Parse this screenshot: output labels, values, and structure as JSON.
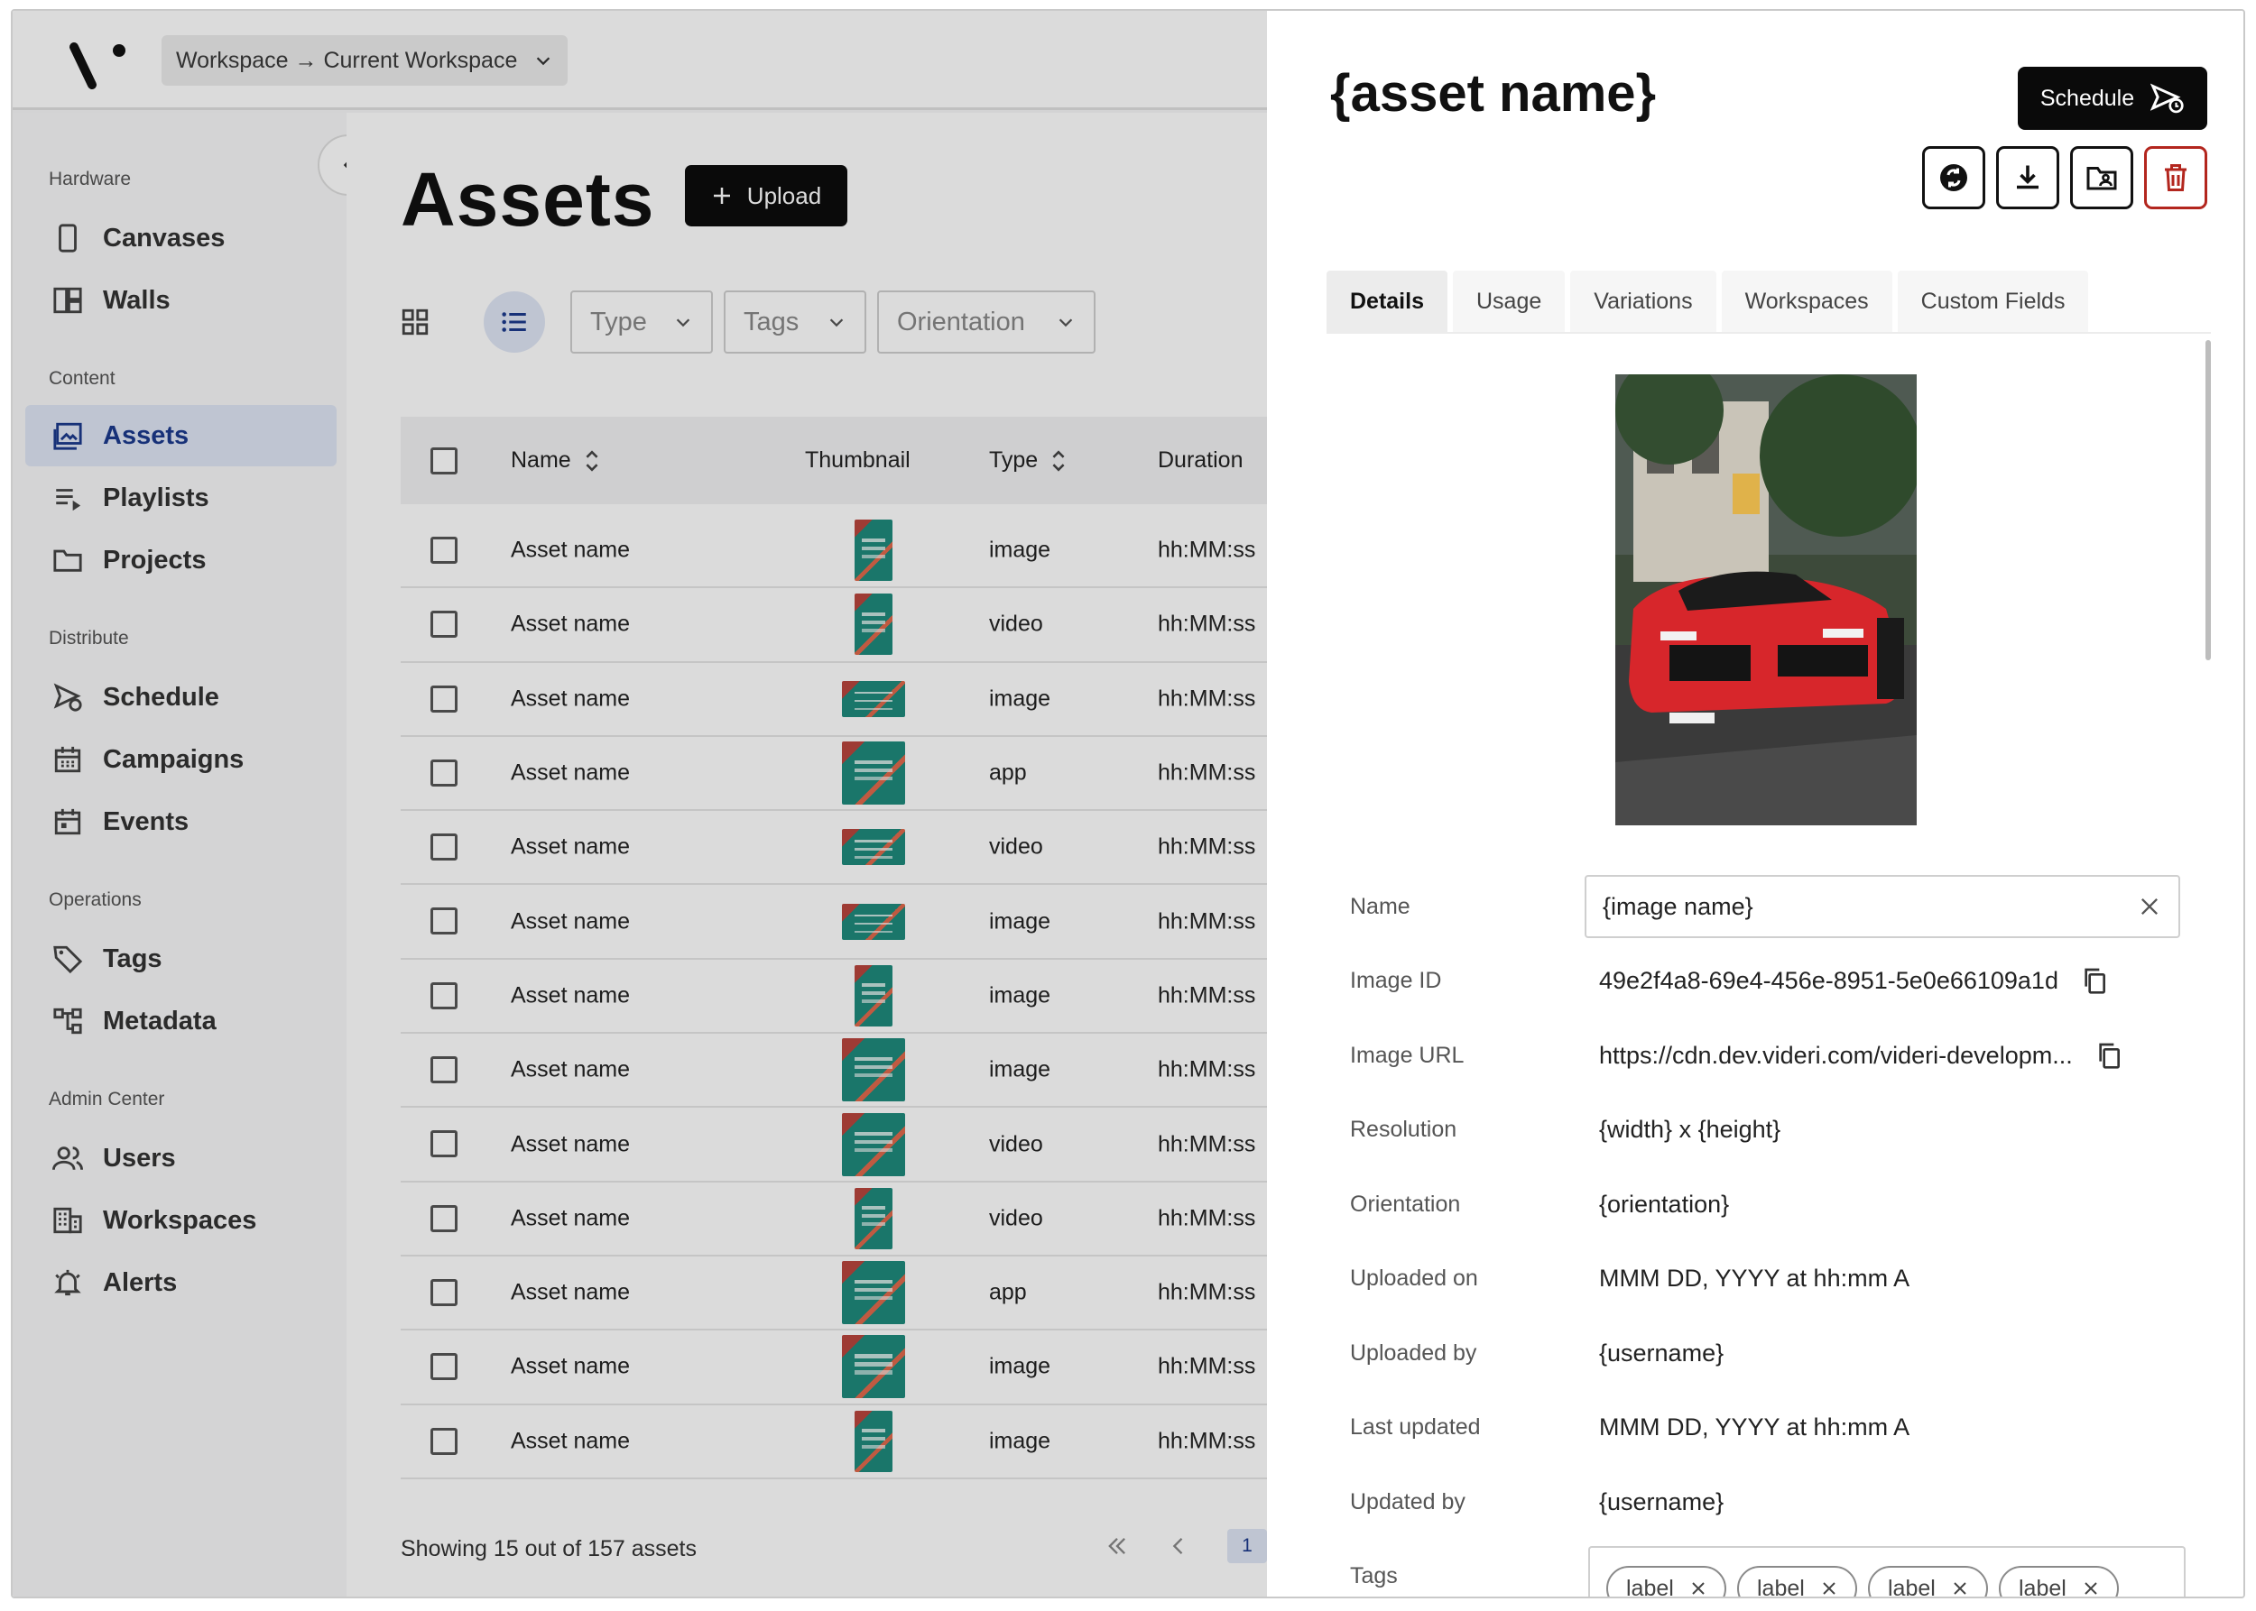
{
  "topbar": {
    "workspace_select": "Workspace → Current Workspace"
  },
  "sidebar": {
    "groups": [
      {
        "label": "Hardware",
        "items": [
          "Canvases",
          "Walls"
        ]
      },
      {
        "label": "Content",
        "items": [
          "Assets",
          "Playlists",
          "Projects"
        ]
      },
      {
        "label": "Distribute",
        "items": [
          "Schedule",
          "Campaigns",
          "Events"
        ]
      },
      {
        "label": "Operations",
        "items": [
          "Tags",
          "Metadata"
        ]
      },
      {
        "label": "Admin Center",
        "items": [
          "Users",
          "Workspaces",
          "Alerts"
        ]
      }
    ],
    "active_item": "Assets"
  },
  "main": {
    "title": "Assets",
    "upload_label": "Upload",
    "filters": [
      "Type",
      "Tags",
      "Orientation"
    ],
    "table": {
      "columns": [
        "Name",
        "Thumbnail",
        "Type",
        "Duration"
      ],
      "rows": [
        {
          "name": "Asset name",
          "thumb": "portrait",
          "type": "image",
          "duration": "hh:MM:ss"
        },
        {
          "name": "Asset name",
          "thumb": "portrait",
          "type": "video",
          "duration": "hh:MM:ss"
        },
        {
          "name": "Asset name",
          "thumb": "landscape",
          "type": "image",
          "duration": "hh:MM:ss"
        },
        {
          "name": "Asset name",
          "thumb": "square",
          "type": "app",
          "duration": "hh:MM:ss"
        },
        {
          "name": "Asset name",
          "thumb": "landscape",
          "type": "video",
          "duration": "hh:MM:ss"
        },
        {
          "name": "Asset name",
          "thumb": "landscape",
          "type": "image",
          "duration": "hh:MM:ss"
        },
        {
          "name": "Asset name",
          "thumb": "portrait",
          "type": "image",
          "duration": "hh:MM:ss"
        },
        {
          "name": "Asset name",
          "thumb": "square",
          "type": "image",
          "duration": "hh:MM:ss"
        },
        {
          "name": "Asset name",
          "thumb": "square",
          "type": "video",
          "duration": "hh:MM:ss"
        },
        {
          "name": "Asset name",
          "thumb": "portrait",
          "type": "video",
          "duration": "hh:MM:ss"
        },
        {
          "name": "Asset name",
          "thumb": "square",
          "type": "app",
          "duration": "hh:MM:ss"
        },
        {
          "name": "Asset name",
          "thumb": "square",
          "type": "image",
          "duration": "hh:MM:ss"
        },
        {
          "name": "Asset name",
          "thumb": "portrait",
          "type": "image",
          "duration": "hh:MM:ss"
        }
      ]
    },
    "footer_text": "Showing 15 out of 157 assets",
    "current_page": "1"
  },
  "panel": {
    "title": "{asset name}",
    "schedule_label": "Schedule",
    "tabs": [
      "Details",
      "Usage",
      "Variations",
      "Workspaces",
      "Custom Fields"
    ],
    "active_tab": "Details",
    "fields": [
      {
        "label": "Name",
        "value": "{image name}"
      },
      {
        "label": "Image ID",
        "value": "49e2f4a8-69e4-456e-8951-5e0e66109a1d"
      },
      {
        "label": "Image URL",
        "value": "https://cdn.dev.videri.com/videri-developm..."
      },
      {
        "label": "Resolution",
        "value": "{width} x {height}"
      },
      {
        "label": "Orientation",
        "value": "{orientation}"
      },
      {
        "label": "Uploaded on",
        "value": "MMM DD, YYYY at hh:mm A"
      },
      {
        "label": "Uploaded by",
        "value": "{username}"
      },
      {
        "label": "Last updated",
        "value": "MMM DD, YYYY at hh:mm A"
      },
      {
        "label": "Updated by",
        "value": "{username}"
      },
      {
        "label": "Tags",
        "value": ""
      }
    ],
    "tags": [
      "label",
      "label",
      "label",
      "label"
    ]
  },
  "colors": {
    "accent": "#1b3a8c",
    "active_bg": "#dfe6f5",
    "danger": "#b3261e",
    "primary_button": "#0c0c0c"
  }
}
